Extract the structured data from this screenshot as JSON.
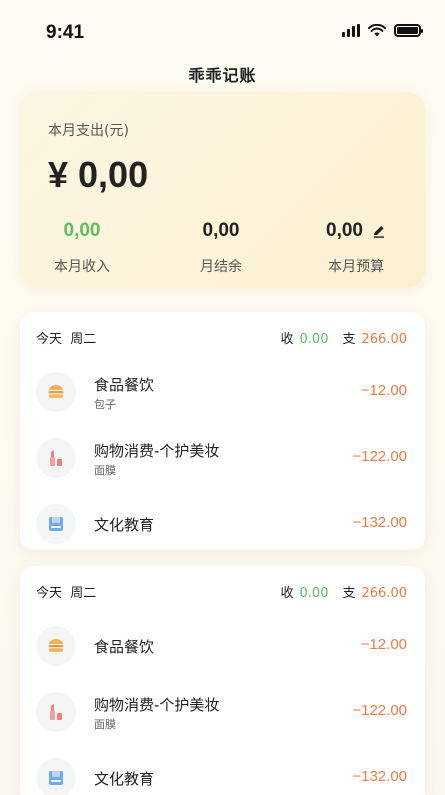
{
  "status_bar": {
    "time": "9:41"
  },
  "app": {
    "title": "乖乖记账"
  },
  "summary": {
    "label": "本月支出(元)",
    "amount": "¥ 0,00",
    "income_value": "0,00",
    "income_label": "本月收入",
    "balance_value": "0,00",
    "balance_label": "月结余",
    "budget_value": "0,00",
    "budget_label": "本月预算"
  },
  "colors": {
    "income": "#5cbf5f",
    "expense": "#f07a45"
  },
  "day_groups": [
    {
      "date": "今天",
      "weekday": "周二",
      "income_label": "收",
      "income": "0.00",
      "expense_label": "支",
      "expense": "266.00",
      "entries": [
        {
          "icon": "burger-icon",
          "name": "食品餐饮",
          "sub": "包子",
          "amount": "−12.00"
        },
        {
          "icon": "lipstick-icon",
          "name": "购物消费-个护美妆",
          "sub": "面膜",
          "amount": "−122.00"
        },
        {
          "icon": "book-icon",
          "name": "文化教育",
          "sub": "",
          "amount": "−132.00"
        }
      ]
    },
    {
      "date": "今天",
      "weekday": "周二",
      "income_label": "收",
      "income": "0.00",
      "expense_label": "支",
      "expense": "266.00",
      "entries": [
        {
          "icon": "burger-icon",
          "name": "食品餐饮",
          "sub": "",
          "amount": "−12.00"
        },
        {
          "icon": "lipstick-icon",
          "name": "购物消费-个护美妆",
          "sub": "面膜",
          "amount": "−122.00"
        },
        {
          "icon": "book-icon",
          "name": "文化教育",
          "sub": "",
          "amount": "−132.00"
        }
      ]
    }
  ]
}
